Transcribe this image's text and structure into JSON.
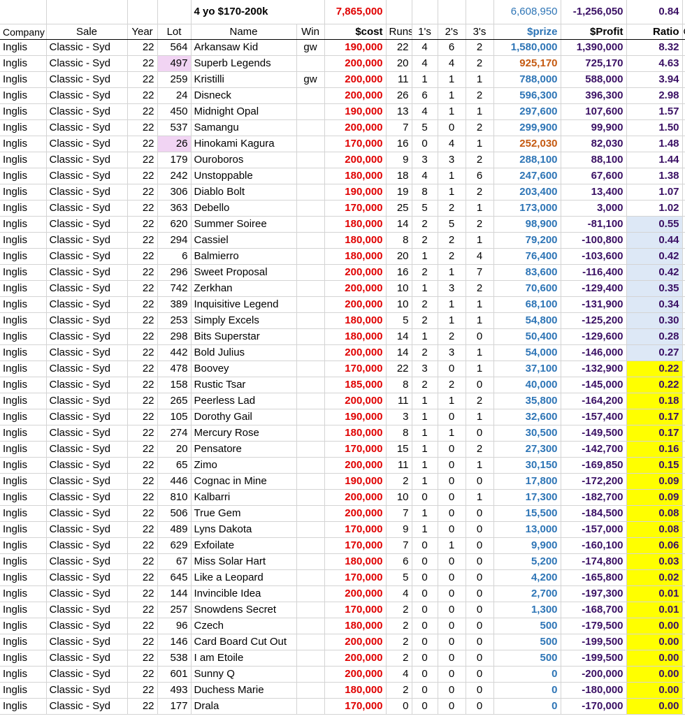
{
  "summary": {
    "title": "4 yo  $170-200k",
    "total_cost": "7,865,000",
    "total_prize": "6,608,950",
    "total_profit": "-1,256,050",
    "total_ratio": "0.84"
  },
  "headers": {
    "company": "Company",
    "sale": "Sale",
    "year": "Year",
    "lot": "Lot",
    "name": "Name",
    "win": "Win",
    "cost": "$cost",
    "runs": "Runs",
    "firsts": "1's",
    "seconds": "2's",
    "thirds": "3's",
    "prize": "$prize",
    "profit": "$Profit",
    "ratio": "Ratio",
    "extra": "C"
  },
  "colors": {
    "cost_red": "#e00000",
    "prize_blue": "#2e75b6",
    "prize_orange": "#c55a11",
    "profit_purple": "#3a1064",
    "lot_highlight": "#f1d4f3",
    "ratio_lightblue": "#dde8f6",
    "ratio_yellow": "#ffff00"
  },
  "rows": [
    {
      "company": "Inglis",
      "sale": "Classic - Syd",
      "year": "22",
      "lot": "564",
      "name": "Arkansaw Kid",
      "win": "gw",
      "cost": "190,000",
      "runs": "22",
      "firsts": "4",
      "seconds": "6",
      "thirds": "2",
      "prize": "1,580,000",
      "profit": "1,390,000",
      "ratio": "8.32"
    },
    {
      "company": "Inglis",
      "sale": "Classic - Syd",
      "year": "22",
      "lot": "497",
      "name": "Superb Legends",
      "win": "",
      "cost": "200,000",
      "runs": "20",
      "firsts": "4",
      "seconds": "4",
      "thirds": "2",
      "prize": "925,170",
      "profit": "725,170",
      "ratio": "4.63"
    },
    {
      "company": "Inglis",
      "sale": "Classic - Syd",
      "year": "22",
      "lot": "259",
      "name": "Kristilli",
      "win": "gw",
      "cost": "200,000",
      "runs": "11",
      "firsts": "1",
      "seconds": "1",
      "thirds": "1",
      "prize": "788,000",
      "profit": "588,000",
      "ratio": "3.94"
    },
    {
      "company": "Inglis",
      "sale": "Classic - Syd",
      "year": "22",
      "lot": "24",
      "name": "Disneck",
      "win": "",
      "cost": "200,000",
      "runs": "26",
      "firsts": "6",
      "seconds": "1",
      "thirds": "2",
      "prize": "596,300",
      "profit": "396,300",
      "ratio": "2.98"
    },
    {
      "company": "Inglis",
      "sale": "Classic - Syd",
      "year": "22",
      "lot": "450",
      "name": "Midnight Opal",
      "win": "",
      "cost": "190,000",
      "runs": "13",
      "firsts": "4",
      "seconds": "1",
      "thirds": "1",
      "prize": "297,600",
      "profit": "107,600",
      "ratio": "1.57"
    },
    {
      "company": "Inglis",
      "sale": "Classic - Syd",
      "year": "22",
      "lot": "537",
      "name": "Samangu",
      "win": "",
      "cost": "200,000",
      "runs": "7",
      "firsts": "5",
      "seconds": "0",
      "thirds": "2",
      "prize": "299,900",
      "profit": "99,900",
      "ratio": "1.50"
    },
    {
      "company": "Inglis",
      "sale": "Classic - Syd",
      "year": "22",
      "lot": "26",
      "name": "Hinokami Kagura",
      "win": "",
      "cost": "170,000",
      "runs": "16",
      "firsts": "0",
      "seconds": "4",
      "thirds": "1",
      "prize": "252,030",
      "profit": "82,030",
      "ratio": "1.48"
    },
    {
      "company": "Inglis",
      "sale": "Classic - Syd",
      "year": "22",
      "lot": "179",
      "name": "Ouroboros",
      "win": "",
      "cost": "200,000",
      "runs": "9",
      "firsts": "3",
      "seconds": "3",
      "thirds": "2",
      "prize": "288,100",
      "profit": "88,100",
      "ratio": "1.44"
    },
    {
      "company": "Inglis",
      "sale": "Classic - Syd",
      "year": "22",
      "lot": "242",
      "name": "Unstoppable",
      "win": "",
      "cost": "180,000",
      "runs": "18",
      "firsts": "4",
      "seconds": "1",
      "thirds": "6",
      "prize": "247,600",
      "profit": "67,600",
      "ratio": "1.38"
    },
    {
      "company": "Inglis",
      "sale": "Classic - Syd",
      "year": "22",
      "lot": "306",
      "name": "Diablo Bolt",
      "win": "",
      "cost": "190,000",
      "runs": "19",
      "firsts": "8",
      "seconds": "1",
      "thirds": "2",
      "prize": "203,400",
      "profit": "13,400",
      "ratio": "1.07"
    },
    {
      "company": "Inglis",
      "sale": "Classic - Syd",
      "year": "22",
      "lot": "363",
      "name": "Debello",
      "win": "",
      "cost": "170,000",
      "runs": "25",
      "firsts": "5",
      "seconds": "2",
      "thirds": "1",
      "prize": "173,000",
      "profit": "3,000",
      "ratio": "1.02"
    },
    {
      "company": "Inglis",
      "sale": "Classic - Syd",
      "year": "22",
      "lot": "620",
      "name": "Summer Soiree",
      "win": "",
      "cost": "180,000",
      "runs": "14",
      "firsts": "2",
      "seconds": "5",
      "thirds": "2",
      "prize": "98,900",
      "profit": "-81,100",
      "ratio": "0.55"
    },
    {
      "company": "Inglis",
      "sale": "Classic - Syd",
      "year": "22",
      "lot": "294",
      "name": "Cassiel",
      "win": "",
      "cost": "180,000",
      "runs": "8",
      "firsts": "2",
      "seconds": "2",
      "thirds": "1",
      "prize": "79,200",
      "profit": "-100,800",
      "ratio": "0.44"
    },
    {
      "company": "Inglis",
      "sale": "Classic - Syd",
      "year": "22",
      "lot": "6",
      "name": "Balmierro",
      "win": "",
      "cost": "180,000",
      "runs": "20",
      "firsts": "1",
      "seconds": "2",
      "thirds": "4",
      "prize": "76,400",
      "profit": "-103,600",
      "ratio": "0.42"
    },
    {
      "company": "Inglis",
      "sale": "Classic - Syd",
      "year": "22",
      "lot": "296",
      "name": "Sweet Proposal",
      "win": "",
      "cost": "200,000",
      "runs": "16",
      "firsts": "2",
      "seconds": "1",
      "thirds": "7",
      "prize": "83,600",
      "profit": "-116,400",
      "ratio": "0.42"
    },
    {
      "company": "Inglis",
      "sale": "Classic - Syd",
      "year": "22",
      "lot": "742",
      "name": "Zerkhan",
      "win": "",
      "cost": "200,000",
      "runs": "10",
      "firsts": "1",
      "seconds": "3",
      "thirds": "2",
      "prize": "70,600",
      "profit": "-129,400",
      "ratio": "0.35"
    },
    {
      "company": "Inglis",
      "sale": "Classic - Syd",
      "year": "22",
      "lot": "389",
      "name": "Inquisitive Legend",
      "win": "",
      "cost": "200,000",
      "runs": "10",
      "firsts": "2",
      "seconds": "1",
      "thirds": "1",
      "prize": "68,100",
      "profit": "-131,900",
      "ratio": "0.34"
    },
    {
      "company": "Inglis",
      "sale": "Classic - Syd",
      "year": "22",
      "lot": "253",
      "name": "Simply Excels",
      "win": "",
      "cost": "180,000",
      "runs": "5",
      "firsts": "2",
      "seconds": "1",
      "thirds": "1",
      "prize": "54,800",
      "profit": "-125,200",
      "ratio": "0.30"
    },
    {
      "company": "Inglis",
      "sale": "Classic - Syd",
      "year": "22",
      "lot": "298",
      "name": "Bits Superstar",
      "win": "",
      "cost": "180,000",
      "runs": "14",
      "firsts": "1",
      "seconds": "2",
      "thirds": "0",
      "prize": "50,400",
      "profit": "-129,600",
      "ratio": "0.28"
    },
    {
      "company": "Inglis",
      "sale": "Classic - Syd",
      "year": "22",
      "lot": "442",
      "name": "Bold Julius",
      "win": "",
      "cost": "200,000",
      "runs": "14",
      "firsts": "2",
      "seconds": "3",
      "thirds": "1",
      "prize": "54,000",
      "profit": "-146,000",
      "ratio": "0.27"
    },
    {
      "company": "Inglis",
      "sale": "Classic - Syd",
      "year": "22",
      "lot": "478",
      "name": "Boovey",
      "win": "",
      "cost": "170,000",
      "runs": "22",
      "firsts": "3",
      "seconds": "0",
      "thirds": "1",
      "prize": "37,100",
      "profit": "-132,900",
      "ratio": "0.22"
    },
    {
      "company": "Inglis",
      "sale": "Classic - Syd",
      "year": "22",
      "lot": "158",
      "name": "Rustic Tsar",
      "win": "",
      "cost": "185,000",
      "runs": "8",
      "firsts": "2",
      "seconds": "2",
      "thirds": "0",
      "prize": "40,000",
      "profit": "-145,000",
      "ratio": "0.22"
    },
    {
      "company": "Inglis",
      "sale": "Classic - Syd",
      "year": "22",
      "lot": "265",
      "name": "Peerless Lad",
      "win": "",
      "cost": "200,000",
      "runs": "11",
      "firsts": "1",
      "seconds": "1",
      "thirds": "2",
      "prize": "35,800",
      "profit": "-164,200",
      "ratio": "0.18"
    },
    {
      "company": "Inglis",
      "sale": "Classic - Syd",
      "year": "22",
      "lot": "105",
      "name": "Dorothy Gail",
      "win": "",
      "cost": "190,000",
      "runs": "3",
      "firsts": "1",
      "seconds": "0",
      "thirds": "1",
      "prize": "32,600",
      "profit": "-157,400",
      "ratio": "0.17"
    },
    {
      "company": "Inglis",
      "sale": "Classic - Syd",
      "year": "22",
      "lot": "274",
      "name": "Mercury Rose",
      "win": "",
      "cost": "180,000",
      "runs": "8",
      "firsts": "1",
      "seconds": "1",
      "thirds": "0",
      "prize": "30,500",
      "profit": "-149,500",
      "ratio": "0.17"
    },
    {
      "company": "Inglis",
      "sale": "Classic - Syd",
      "year": "22",
      "lot": "20",
      "name": "Pensatore",
      "win": "",
      "cost": "170,000",
      "runs": "15",
      "firsts": "1",
      "seconds": "0",
      "thirds": "2",
      "prize": "27,300",
      "profit": "-142,700",
      "ratio": "0.16"
    },
    {
      "company": "Inglis",
      "sale": "Classic - Syd",
      "year": "22",
      "lot": "65",
      "name": "Zimo",
      "win": "",
      "cost": "200,000",
      "runs": "11",
      "firsts": "1",
      "seconds": "0",
      "thirds": "1",
      "prize": "30,150",
      "profit": "-169,850",
      "ratio": "0.15"
    },
    {
      "company": "Inglis",
      "sale": "Classic - Syd",
      "year": "22",
      "lot": "446",
      "name": "Cognac in Mine",
      "win": "",
      "cost": "190,000",
      "runs": "2",
      "firsts": "1",
      "seconds": "0",
      "thirds": "0",
      "prize": "17,800",
      "profit": "-172,200",
      "ratio": "0.09"
    },
    {
      "company": "Inglis",
      "sale": "Classic - Syd",
      "year": "22",
      "lot": "810",
      "name": "Kalbarri",
      "win": "",
      "cost": "200,000",
      "runs": "10",
      "firsts": "0",
      "seconds": "0",
      "thirds": "1",
      "prize": "17,300",
      "profit": "-182,700",
      "ratio": "0.09"
    },
    {
      "company": "Inglis",
      "sale": "Classic - Syd",
      "year": "22",
      "lot": "506",
      "name": "True Gem",
      "win": "",
      "cost": "200,000",
      "runs": "7",
      "firsts": "1",
      "seconds": "0",
      "thirds": "0",
      "prize": "15,500",
      "profit": "-184,500",
      "ratio": "0.08"
    },
    {
      "company": "Inglis",
      "sale": "Classic - Syd",
      "year": "22",
      "lot": "489",
      "name": "Lyns Dakota",
      "win": "",
      "cost": "170,000",
      "runs": "9",
      "firsts": "1",
      "seconds": "0",
      "thirds": "0",
      "prize": "13,000",
      "profit": "-157,000",
      "ratio": "0.08"
    },
    {
      "company": "Inglis",
      "sale": "Classic - Syd",
      "year": "22",
      "lot": "629",
      "name": "Exfoilate",
      "win": "",
      "cost": "170,000",
      "runs": "7",
      "firsts": "0",
      "seconds": "1",
      "thirds": "0",
      "prize": "9,900",
      "profit": "-160,100",
      "ratio": "0.06"
    },
    {
      "company": "Inglis",
      "sale": "Classic - Syd",
      "year": "22",
      "lot": "67",
      "name": "Miss Solar Hart",
      "win": "",
      "cost": "180,000",
      "runs": "6",
      "firsts": "0",
      "seconds": "0",
      "thirds": "0",
      "prize": "5,200",
      "profit": "-174,800",
      "ratio": "0.03"
    },
    {
      "company": "Inglis",
      "sale": "Classic - Syd",
      "year": "22",
      "lot": "645",
      "name": "Like a Leopard",
      "win": "",
      "cost": "170,000",
      "runs": "5",
      "firsts": "0",
      "seconds": "0",
      "thirds": "0",
      "prize": "4,200",
      "profit": "-165,800",
      "ratio": "0.02"
    },
    {
      "company": "Inglis",
      "sale": "Classic - Syd",
      "year": "22",
      "lot": "144",
      "name": "Invincible Idea",
      "win": "",
      "cost": "200,000",
      "runs": "4",
      "firsts": "0",
      "seconds": "0",
      "thirds": "0",
      "prize": "2,700",
      "profit": "-197,300",
      "ratio": "0.01"
    },
    {
      "company": "Inglis",
      "sale": "Classic - Syd",
      "year": "22",
      "lot": "257",
      "name": "Snowdens Secret",
      "win": "",
      "cost": "170,000",
      "runs": "2",
      "firsts": "0",
      "seconds": "0",
      "thirds": "0",
      "prize": "1,300",
      "profit": "-168,700",
      "ratio": "0.01"
    },
    {
      "company": "Inglis",
      "sale": "Classic - Syd",
      "year": "22",
      "lot": "96",
      "name": "Czech",
      "win": "",
      "cost": "180,000",
      "runs": "2",
      "firsts": "0",
      "seconds": "0",
      "thirds": "0",
      "prize": "500",
      "profit": "-179,500",
      "ratio": "0.00"
    },
    {
      "company": "Inglis",
      "sale": "Classic - Syd",
      "year": "22",
      "lot": "146",
      "name": "Card Board Cut Out",
      "win": "",
      "cost": "200,000",
      "runs": "2",
      "firsts": "0",
      "seconds": "0",
      "thirds": "0",
      "prize": "500",
      "profit": "-199,500",
      "ratio": "0.00"
    },
    {
      "company": "Inglis",
      "sale": "Classic - Syd",
      "year": "22",
      "lot": "538",
      "name": "I am Etoile",
      "win": "",
      "cost": "200,000",
      "runs": "2",
      "firsts": "0",
      "seconds": "0",
      "thirds": "0",
      "prize": "500",
      "profit": "-199,500",
      "ratio": "0.00"
    },
    {
      "company": "Inglis",
      "sale": "Classic - Syd",
      "year": "22",
      "lot": "601",
      "name": "Sunny Q",
      "win": "",
      "cost": "200,000",
      "runs": "4",
      "firsts": "0",
      "seconds": "0",
      "thirds": "0",
      "prize": "0",
      "profit": "-200,000",
      "ratio": "0.00"
    },
    {
      "company": "Inglis",
      "sale": "Classic - Syd",
      "year": "22",
      "lot": "493",
      "name": "Duchess Marie",
      "win": "",
      "cost": "180,000",
      "runs": "2",
      "firsts": "0",
      "seconds": "0",
      "thirds": "0",
      "prize": "0",
      "profit": "-180,000",
      "ratio": "0.00"
    },
    {
      "company": "Inglis",
      "sale": "Classic - Syd",
      "year": "22",
      "lot": "177",
      "name": "Drala",
      "win": "",
      "cost": "170,000",
      "runs": "0",
      "firsts": "0",
      "seconds": "0",
      "thirds": "0",
      "prize": "0",
      "profit": "-170,000",
      "ratio": "0.00"
    }
  ]
}
